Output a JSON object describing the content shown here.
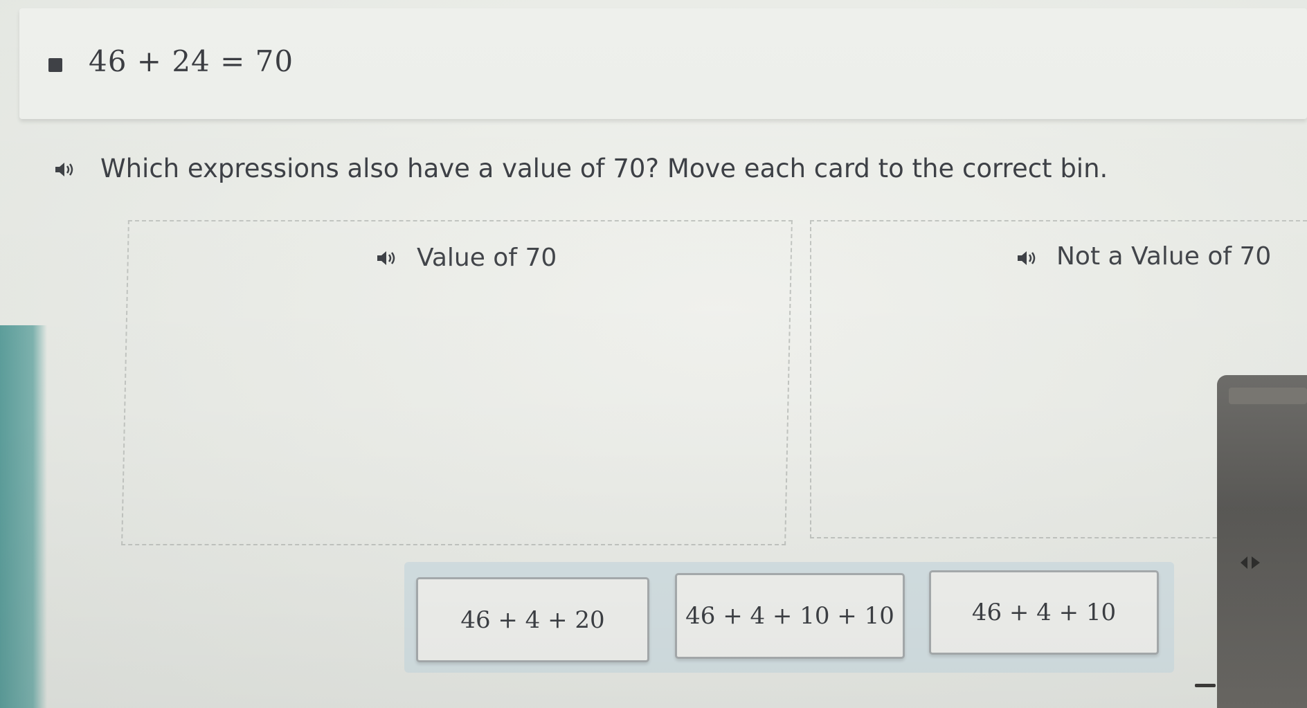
{
  "equation": {
    "text": "46 + 24 = 70"
  },
  "question": {
    "text": "Which expressions also have a value of 70? Move each card to the correct bin."
  },
  "bins": [
    {
      "title": "Value of 70"
    },
    {
      "title": "Not a Value of 70"
    }
  ],
  "cards": [
    {
      "expression": "46 + 4 + 20"
    },
    {
      "expression": "46 + 4 + 10 + 10"
    },
    {
      "expression": "46 + 4 + 10"
    }
  ],
  "icons": {
    "audio": "speaker-icon",
    "bullet": "square-bullet-icon",
    "nav": "diamond-arrow-icon"
  },
  "colors": {
    "background": "#e9ebe7",
    "text": "#3c3f44",
    "card_border": "#a9aeb0",
    "tray": "#d6e2e5",
    "bin_border": "#c3c6c2"
  }
}
